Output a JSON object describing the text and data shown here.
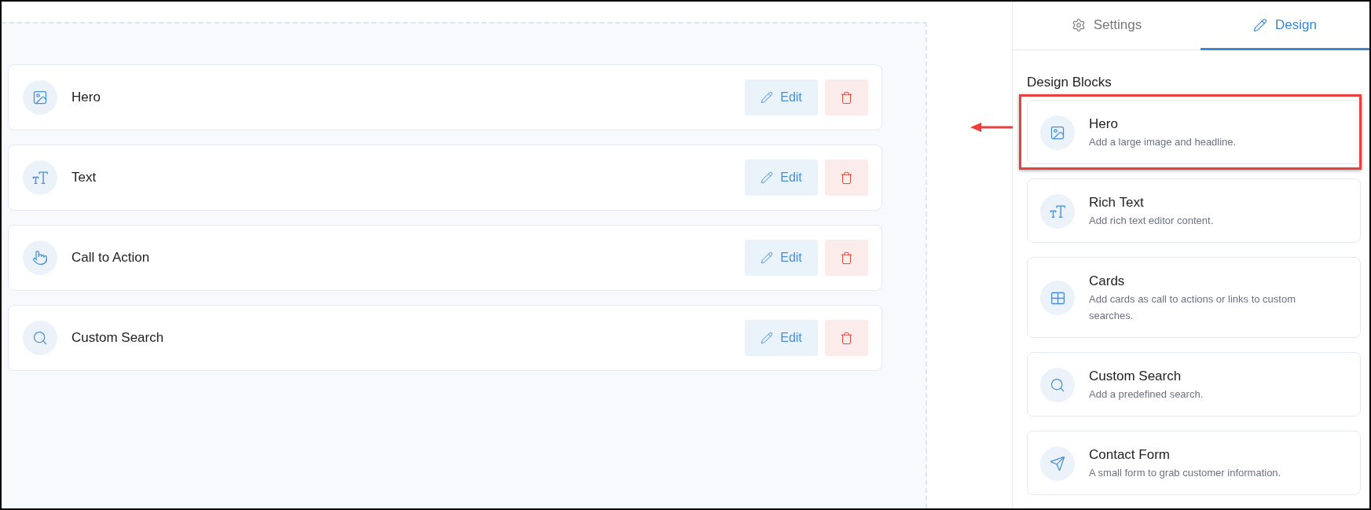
{
  "canvas": {
    "blocks": [
      {
        "kind": "hero",
        "label": "Hero",
        "edit_label": "Edit"
      },
      {
        "kind": "text",
        "label": "Text",
        "edit_label": "Edit"
      },
      {
        "kind": "cta",
        "label": "Call to Action",
        "edit_label": "Edit"
      },
      {
        "kind": "search",
        "label": "Custom Search",
        "edit_label": "Edit"
      }
    ]
  },
  "panel": {
    "tabs": [
      {
        "kind": "settings",
        "label": "Settings",
        "selected": false
      },
      {
        "kind": "design",
        "label": "Design",
        "selected": true
      }
    ],
    "heading": "Design Blocks",
    "blocks": [
      {
        "kind": "hero",
        "title": "Hero",
        "description": "Add a large image and headline.",
        "highlighted": true
      },
      {
        "kind": "text",
        "title": "Rich Text",
        "description": "Add rich text editor content.",
        "highlighted": false
      },
      {
        "kind": "cards",
        "title": "Cards",
        "description": "Add cards as call to actions or links to custom searches.",
        "highlighted": false
      },
      {
        "kind": "search",
        "title": "Custom Search",
        "description": "Add a predefined search.",
        "highlighted": false
      },
      {
        "kind": "form",
        "title": "Contact Form",
        "description": "A small form to grab customer information.",
        "highlighted": false
      }
    ]
  }
}
